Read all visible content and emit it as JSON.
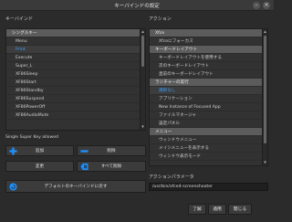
{
  "window": {
    "title": "キーバインドの設定"
  },
  "left_panel": {
    "title": "キーバインド",
    "items": [
      {
        "label": "シングルキー",
        "type": "header"
      },
      {
        "label": "Menu",
        "type": "item"
      },
      {
        "label": "Print",
        "type": "selected"
      },
      {
        "label": "Execute",
        "type": "item"
      },
      {
        "label": "Super_L",
        "type": "item"
      },
      {
        "label": "XF86Sleep",
        "type": "item"
      },
      {
        "label": "XF86Start",
        "type": "item"
      },
      {
        "label": "XF86Standby",
        "type": "item"
      },
      {
        "label": "XF86Suspend",
        "type": "item"
      },
      {
        "label": "XF86PowerOff",
        "type": "item"
      },
      {
        "label": "XF86AudioMute",
        "type": "item"
      }
    ],
    "note": "Single Super Key allowed"
  },
  "buttons": {
    "add": "追加",
    "delete": "削除",
    "change": "変更",
    "delete_all": "すべて削除",
    "reset_default": "デフォルトのキーバインドに戻す"
  },
  "right_panel": {
    "title": "アクション",
    "items": [
      {
        "label": "Xfce",
        "type": "header"
      },
      {
        "label": "Xfceにフォーカス",
        "type": "item"
      },
      {
        "label": "キーボードレイアウト",
        "type": "header"
      },
      {
        "label": "キーボードレイアウトを使用する",
        "type": "item"
      },
      {
        "label": "次のキーボードレイアウト",
        "type": "item"
      },
      {
        "label": "直前のキーボードレイアウト",
        "type": "item"
      },
      {
        "label": "ランチャーの実行",
        "type": "header"
      },
      {
        "label": "選択なし",
        "type": "selected"
      },
      {
        "label": "アプリケーション",
        "type": "item"
      },
      {
        "label": "New Instance of Focused App",
        "type": "item"
      },
      {
        "label": "ファイルマネージャ",
        "type": "item"
      },
      {
        "label": "設定パネル",
        "type": "item"
      },
      {
        "label": "メニュー",
        "type": "header"
      },
      {
        "label": "ウィンドウメニュー",
        "type": "item"
      },
      {
        "label": "メインメニューを表示する",
        "type": "item"
      },
      {
        "label": "ウィンドウ表示モード",
        "type": "item"
      }
    ],
    "param_title": "アクションパラメータ",
    "param_value": "/usr/bin/xfce4-screenshooter"
  },
  "dialog_buttons": {
    "ok": "了解",
    "apply": "適用",
    "close": "閉じる"
  },
  "colors": {
    "accent": "#3ea0ff",
    "add_icon": "#1e90ff",
    "delete_icon": "#1e90ff"
  }
}
